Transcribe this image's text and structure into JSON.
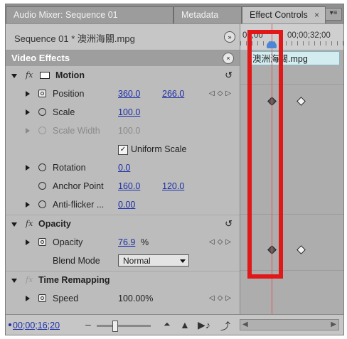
{
  "tabs": [
    {
      "label": "Audio Mixer: Sequence 01"
    },
    {
      "label": "Metadata"
    },
    {
      "label": "Effect Controls",
      "close": "×"
    }
  ],
  "source": {
    "label": "Sequence 01 * 澳洲海關.mpg"
  },
  "panel": {
    "title": "Video Effects"
  },
  "motion": {
    "title": "Motion",
    "position": {
      "label": "Position",
      "x": "360.0",
      "y": "266.0"
    },
    "scale": {
      "label": "Scale",
      "value": "100.0"
    },
    "scale_width": {
      "label": "Scale Width",
      "value": "100.0"
    },
    "uniform": {
      "label": "Uniform Scale",
      "checked": true
    },
    "rotation": {
      "label": "Rotation",
      "value": "0.0"
    },
    "anchor": {
      "label": "Anchor Point",
      "x": "160.0",
      "y": "120.0"
    },
    "antiflicker": {
      "label": "Anti-flicker ...",
      "value": "0.00"
    }
  },
  "opacity": {
    "title": "Opacity",
    "opacity": {
      "label": "Opacity",
      "value": "76.9",
      "unit": "%"
    },
    "blend": {
      "label": "Blend Mode",
      "value": "Normal"
    }
  },
  "time_remap": {
    "title": "Time Remapping",
    "speed": {
      "label": "Speed",
      "value": "100.00%"
    }
  },
  "timeline": {
    "start": "00;00",
    "end": "00;00;32;00",
    "clip": "澳洲海關.mpg"
  },
  "footer": {
    "timecode": "00;00;16;20"
  },
  "colors": {
    "highlight": "#e01818",
    "cti": "#e35959",
    "link": "#1b2ea8",
    "clip": "#d3ecf0"
  },
  "icons": [
    "fx-icon",
    "motion-icon",
    "stopwatch-icon",
    "reset-icon",
    "keyframe-nav-icon",
    "keyframe-icon",
    "play-audio-icon",
    "export-icon"
  ]
}
